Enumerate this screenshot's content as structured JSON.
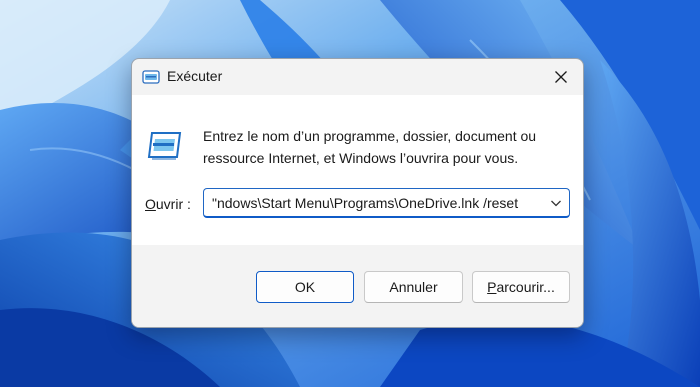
{
  "dialog": {
    "title": "Exécuter",
    "description": "Entrez le nom d’un programme, dossier, document ou ressource Internet, et Windows l’ouvrira pour vous.",
    "open_label_accesskey": "O",
    "open_label_rest": "uvrir :",
    "open_value": "ndows\\Start Menu\\Programs\\OneDrive.lnk /reset\""
  },
  "buttons": {
    "ok": "OK",
    "cancel": "Annuler",
    "browse_accesskey": "P",
    "browse_rest": "arcourir..."
  },
  "icons": {
    "title": "run-icon",
    "large": "run-icon",
    "close": "close-icon",
    "dropdown": "chevron-down-icon"
  },
  "colors": {
    "accent": "#0f5bc7",
    "dialog_bg": "#f3f3f3",
    "content_bg": "#ffffff",
    "wallpaper": "#2f7de0"
  }
}
